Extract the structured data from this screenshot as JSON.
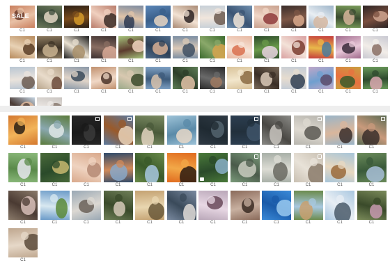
{
  "top_panel": {
    "columns": 14,
    "items": [
      {
        "label": "C1",
        "overlay": "SALE",
        "colors": [
          "#c97f5e",
          "#6b3b2a",
          "#e8c1a6"
        ]
      },
      {
        "label": "C1",
        "colors": [
          "#6d7a5c",
          "#e3d7c4",
          "#3b4a3a"
        ]
      },
      {
        "label": "C1",
        "colors": [
          "#2c2016",
          "#d59a2a",
          "#7a4c1c"
        ]
      },
      {
        "label": "C1",
        "colors": [
          "#b87b6a",
          "#3a2a24",
          "#f0d0bf"
        ]
      },
      {
        "label": "C1",
        "colors": [
          "#7b8aa0",
          "#2d3a52",
          "#e0c4a8"
        ]
      },
      {
        "label": "C1",
        "colors": [
          "#5b86b8",
          "#e7d5c2",
          "#3a5f8a"
        ]
      },
      {
        "label": "C1",
        "colors": [
          "#a98a74",
          "#2b2222",
          "#f2e2d3"
        ]
      },
      {
        "label": "C1",
        "colors": [
          "#c7d0d8",
          "#6c5a50",
          "#f1e6dc"
        ]
      },
      {
        "label": "C1",
        "colors": [
          "#6f8faf",
          "#f2e6d9",
          "#3b5473"
        ]
      },
      {
        "label": "C1",
        "colors": [
          "#c8a08d",
          "#8e3a3a",
          "#f1d7c7"
        ]
      },
      {
        "label": "C1",
        "colors": [
          "#3a2d2a",
          "#d9a98c",
          "#7d5746"
        ]
      },
      {
        "label": "C1",
        "colors": [
          "#9bb3c8",
          "#d5b7a1",
          "#e9eef3"
        ]
      },
      {
        "label": "C1",
        "colors": [
          "#7a9c5a",
          "#d6b59a",
          "#3a4a30"
        ]
      },
      {
        "label": "C1",
        "colors": [
          "#2c2424",
          "#cfa58f",
          "#7a4f3f"
        ]
      },
      {
        "label": "C1",
        "colors": [
          "#b78a5c",
          "#5a3d25",
          "#e8d2b5"
        ]
      },
      {
        "label": "C1",
        "colors": [
          "#8c7a5f",
          "#c9b391",
          "#3f3427"
        ]
      },
      {
        "label": "C1",
        "colors": [
          "#1f1f1f",
          "#a88f6b",
          "#e9e0d0"
        ]
      },
      {
        "label": "C1",
        "colors": [
          "#3b2f2f",
          "#d8a996",
          "#8a6e62"
        ]
      },
      {
        "label": "C1",
        "colors": [
          "#a6c37c",
          "#f2d4c0",
          "#5c3b2e"
        ]
      },
      {
        "label": "C1",
        "colors": [
          "#4f6b8a",
          "#d9b094",
          "#2d3f55"
        ]
      },
      {
        "label": "C1",
        "colors": [
          "#7c8fa3",
          "#3e4f63",
          "#dcc9b6"
        ]
      },
      {
        "label": "C1",
        "colors": [
          "#3c6b2e",
          "#d6a34e",
          "#8aa86a"
        ]
      },
      {
        "label": "C1",
        "colors": [
          "#e7b7a0",
          "#d9704f",
          "#f7e4d8"
        ]
      },
      {
        "label": "C1",
        "colors": [
          "#2d4a2a",
          "#e8d4e0",
          "#6a9a4a"
        ]
      },
      {
        "label": "C1",
        "colors": [
          "#d9a0a0",
          "#7a3b2e",
          "#f3e2d8"
        ]
      },
      {
        "label": "C1",
        "colors": [
          "#c43c3c",
          "#4a7a9c",
          "#e8b84a"
        ]
      },
      {
        "label": "C1",
        "colors": [
          "#a06a8c",
          "#3a2a3a",
          "#e8c8d8"
        ]
      },
      {
        "label": "C1",
        "colors": [
          "#c9c9d2",
          "#8a6f64",
          "#f2ede8"
        ]
      },
      {
        "label": "C1",
        "colors": [
          "#b9c6d3",
          "#6b5a50",
          "#eae3dc"
        ]
      },
      {
        "label": "C1",
        "colors": [
          "#b8a58c",
          "#6b4a3a",
          "#e9dccb"
        ]
      },
      {
        "label": "C1",
        "colors": [
          "#8a98a8",
          "#3a4a5a",
          "#e0d4c8"
        ]
      },
      {
        "label": "C1",
        "colors": [
          "#c0906e",
          "#4a3228",
          "#f0d8c6"
        ]
      },
      {
        "label": "C1",
        "colors": [
          "#9aa98a",
          "#3a4a2a",
          "#d8c8b0"
        ]
      },
      {
        "label": "C1",
        "colors": [
          "#7fa1c4",
          "#d7c2ad",
          "#3c5a7a"
        ]
      },
      {
        "label": "C1",
        "colors": [
          "#5e7e56",
          "#e3c3a8",
          "#2e3e2a"
        ]
      },
      {
        "label": "C1",
        "colors": [
          "#2a2a2a",
          "#a07a62",
          "#6a6a6a"
        ]
      },
      {
        "label": "C1",
        "colors": [
          "#d9c39a",
          "#8a6a42",
          "#f2e6cc"
        ]
      },
      {
        "label": "C1",
        "colors": [
          "#7a6a5a",
          "#dccab8",
          "#3a2e26"
        ]
      },
      {
        "label": "C1",
        "colors": [
          "#c4ccd6",
          "#2f3e52",
          "#e6dccf"
        ]
      },
      {
        "label": "C1",
        "colors": [
          "#bfa7c8",
          "#5a4a6a",
          "#6f9fcf"
        ]
      },
      {
        "label": "C1",
        "colors": [
          "#c8a040",
          "#3a5a2a",
          "#e87040"
        ]
      },
      {
        "label": "C1",
        "colors": [
          "#6a9a5a",
          "#dba8b0",
          "#2e4a2e"
        ]
      },
      {
        "label": "C1",
        "colors": [
          "#c7d6e3",
          "#e0b89a",
          "#4a3a34"
        ]
      },
      {
        "label": "C1",
        "colors": [
          "#c9c4c0",
          "#8a7a70",
          "#eeeae6"
        ]
      }
    ]
  },
  "bottom_panel": {
    "columns": 12,
    "items": [
      {
        "label": "C1",
        "colors": [
          "#d4782e",
          "#2a1e14",
          "#f2b45a"
        ]
      },
      {
        "label": "C1",
        "colors": [
          "#5a7a3a",
          "#dfe8e8",
          "#8aa8b0"
        ]
      },
      {
        "label": "C1",
        "badge": true,
        "colors": [
          "#262626",
          "#3a3a3a",
          "#1a1a1a"
        ]
      },
      {
        "label": "C1",
        "badge": true,
        "colors": [
          "#5a7aa0",
          "#e9d2b8",
          "#9a5a2a"
        ]
      },
      {
        "label": "C1",
        "colors": [
          "#7a8a62",
          "#e2d4c0",
          "#4a5a3a"
        ]
      },
      {
        "label": "C1",
        "colors": [
          "#9ec3d8",
          "#e8d8c8",
          "#5a8aa8"
        ]
      },
      {
        "label": "C1",
        "colors": [
          "#2f3a44",
          "#54646e",
          "#1f2a32"
        ]
      },
      {
        "label": "C1",
        "badge": true,
        "colors": [
          "#2c3e50",
          "#3e5468",
          "#22303c"
        ]
      },
      {
        "label": "C1",
        "colors": [
          "#8a8a86",
          "#c9c6c0",
          "#4a4844"
        ]
      },
      {
        "label": "C1",
        "badge": true,
        "colors": [
          "#b7b5ae",
          "#5a5852",
          "#ded9d0"
        ]
      },
      {
        "label": "C1",
        "colors": [
          "#9ab5c8",
          "#3a2e2a",
          "#d9b69c"
        ]
      },
      {
        "label": "C1",
        "badge": true,
        "colors": [
          "#5a6a52",
          "#3a2e2a",
          "#c99a7c"
        ]
      },
      {
        "label": "C1",
        "colors": [
          "#8ab87a",
          "#e8e8f0",
          "#5a8a4a"
        ]
      },
      {
        "label": "C1",
        "colors": [
          "#4a6a3a",
          "#c8b870",
          "#2a4a2a"
        ]
      },
      {
        "label": "C1",
        "colors": [
          "#d9a98c",
          "#b58a74",
          "#efd3c0"
        ]
      },
      {
        "label": "C1",
        "colors": [
          "#2f4a6a",
          "#8aa8c8",
          "#d08a5a"
        ]
      },
      {
        "label": "C1",
        "colors": [
          "#6a8a4a",
          "#a8c8e0",
          "#3a5a2a"
        ]
      },
      {
        "label": "C1",
        "colors": [
          "#e06a1e",
          "#2a1a10",
          "#f2a848"
        ]
      },
      {
        "label": "C1",
        "play": true,
        "colors": [
          "#4a7a3a",
          "#8ab0c8",
          "#2a4a2a"
        ]
      },
      {
        "label": "C1",
        "badge": true,
        "colors": [
          "#7a9a7a",
          "#c9cdc0",
          "#4a5a4a"
        ]
      },
      {
        "label": "C1",
        "colors": [
          "#a9b0a8",
          "#6a6a62",
          "#dcdcd4"
        ]
      },
      {
        "label": "C1",
        "badge": true,
        "colors": [
          "#c9c0b2",
          "#8a7a6a",
          "#e8e2d8"
        ]
      },
      {
        "label": "C1",
        "colors": [
          "#a7c5d9",
          "#9a6a3a",
          "#e8d8c0"
        ]
      },
      {
        "label": "C1",
        "colors": [
          "#6a8a5a",
          "#a8c0d8",
          "#3a5a3a"
        ]
      },
      {
        "label": "C1",
        "colors": [
          "#8a7a6a",
          "#d8c0b8",
          "#4a3a32"
        ]
      },
      {
        "label": "C1",
        "colors": [
          "#6a9ac8",
          "#5a8a3a",
          "#d8e8f0"
        ]
      },
      {
        "label": "C1",
        "colors": [
          "#9aa8b4",
          "#6a6058",
          "#dcd8d2"
        ]
      },
      {
        "label": "C1",
        "colors": [
          "#6f7f58",
          "#d6cab8",
          "#3a4a2a"
        ]
      },
      {
        "label": "C1",
        "colors": [
          "#c4a272",
          "#6a5838",
          "#e8d6b0"
        ]
      },
      {
        "label": "C1",
        "colors": [
          "#7a8aa0",
          "#e0dcd8",
          "#3a4a5a"
        ]
      },
      {
        "label": "C1",
        "colors": [
          "#b9a7b8",
          "#6a4a5a",
          "#e8d8e4"
        ]
      },
      {
        "label": "C1",
        "colors": [
          "#8a6a5a",
          "#3a2a22",
          "#c8b0a0"
        ]
      },
      {
        "label": "C1",
        "colors": [
          "#3a8ad8",
          "#9acaf0",
          "#1a5aa8"
        ]
      },
      {
        "label": "C1",
        "colors": [
          "#6a8a4a",
          "#c8a070",
          "#a8c8e0"
        ]
      },
      {
        "label": "C1",
        "colors": [
          "#a9c7e0",
          "#4a5a6a",
          "#e8eef4"
        ]
      },
      {
        "label": "C1",
        "colors": [
          "#7a8a5a",
          "#c89ab0",
          "#3a4a2a"
        ]
      },
      {
        "label": "C1",
        "colors": [
          "#bfa78f",
          "#5a4a3a",
          "#e6d8c8"
        ]
      }
    ]
  }
}
